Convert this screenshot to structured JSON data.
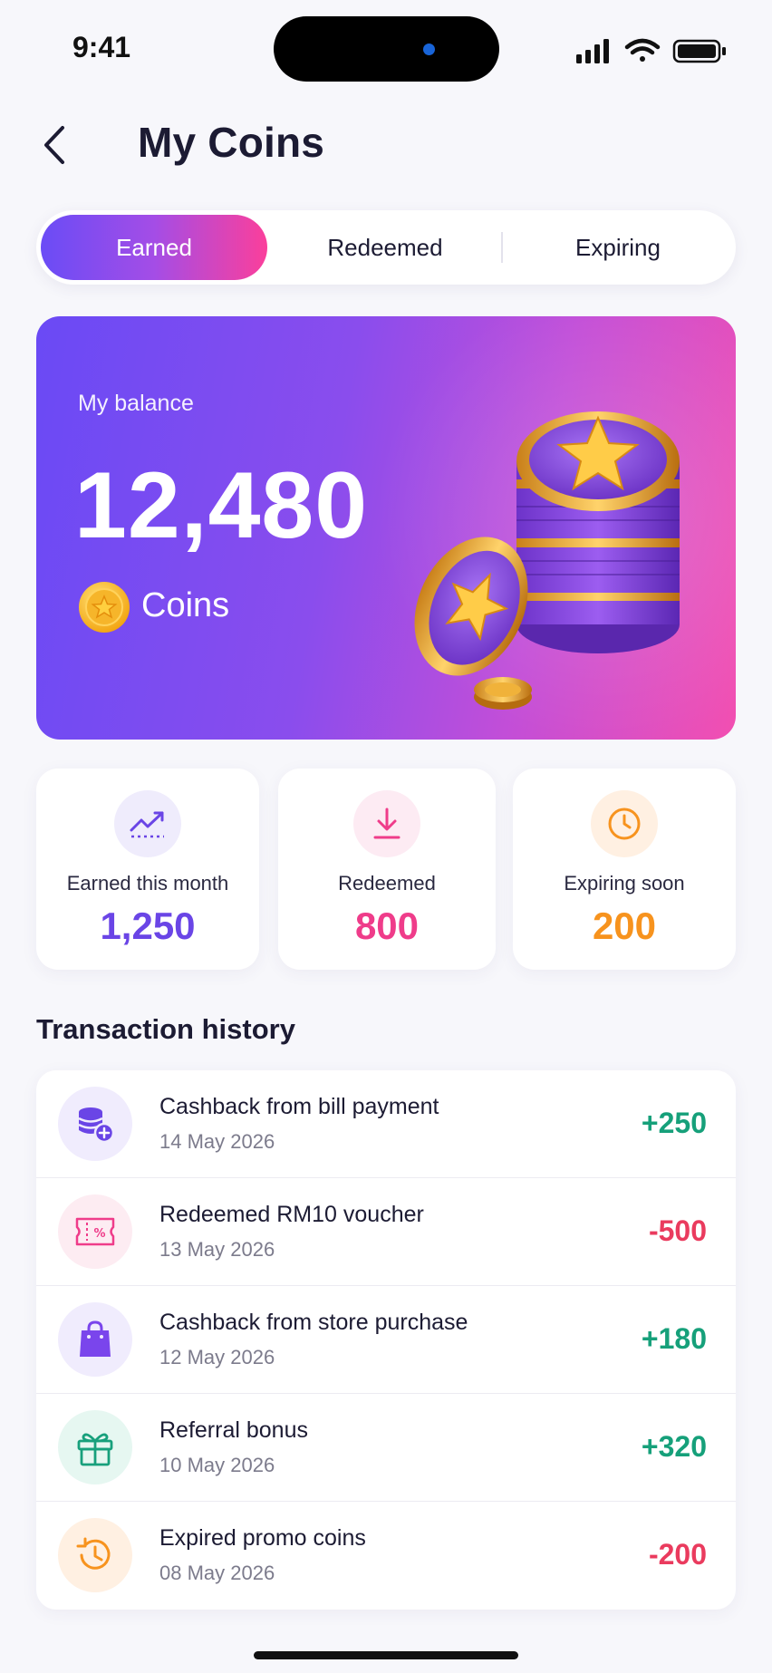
{
  "status_bar": {
    "time": "9:41"
  },
  "header": {
    "title": "My Coins",
    "back_icon": "chevron-left-icon"
  },
  "tabs": [
    {
      "label": "Earned",
      "active": true
    },
    {
      "label": "Redeemed",
      "active": false
    },
    {
      "label": "Expiring",
      "active": false
    }
  ],
  "balance": {
    "label": "My balance",
    "value": "12,480",
    "unit": "Coins"
  },
  "stats": [
    {
      "label": "Earned this month",
      "value": "1,250",
      "color": "#6a45e6",
      "icon": "trend-up-icon"
    },
    {
      "label": "Redeemed",
      "value": "800",
      "color": "#ef3c8a",
      "icon": "download-icon"
    },
    {
      "label": "Expiring soon",
      "value": "200",
      "color": "#f7931e",
      "icon": "clock-icon"
    }
  ],
  "history": {
    "title": "Transaction history",
    "items": [
      {
        "title": "Cashback from bill payment",
        "date": "14 May 2026",
        "amount": "+250",
        "icon": "coins-add-icon",
        "color": "#16a07a"
      },
      {
        "title": "Redeemed RM10 voucher",
        "date": "13 May 2026",
        "amount": "-500",
        "icon": "voucher-icon",
        "color": "#ea3b5e"
      },
      {
        "title": "Cashback from store purchase",
        "date": "12 May 2026",
        "amount": "+180",
        "icon": "shopping-bag-icon",
        "color": "#16a07a"
      },
      {
        "title": "Referral bonus",
        "date": "10 May 2026",
        "amount": "+320",
        "icon": "gift-icon",
        "color": "#16a07a"
      },
      {
        "title": "Expired promo coins",
        "date": "08 May 2026",
        "amount": "-200",
        "icon": "history-clock-icon",
        "color": "#ea3b5e"
      }
    ]
  }
}
